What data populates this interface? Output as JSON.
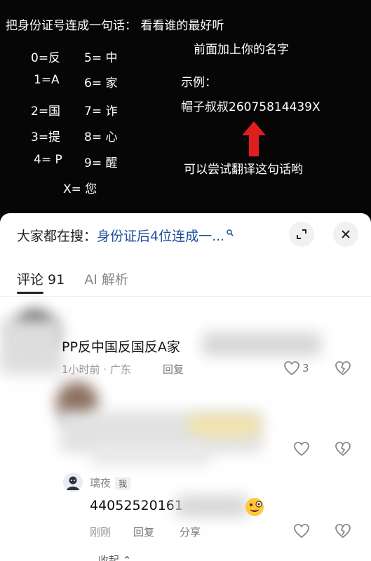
{
  "video": {
    "headline": "把身份证号连成一句话： 看看谁的最好听",
    "mapping": [
      {
        "l": "0=反",
        "r": "5= 中"
      },
      {
        "l": "1=A",
        "r": "6= 家"
      },
      {
        "l": "2=国",
        "r": "7= 诈"
      },
      {
        "l": "3=提",
        "r": "8= 心"
      },
      {
        "l": "4= P",
        "r": "9= 醒"
      }
    ],
    "mapping_x": "X= 您",
    "instruction": "前面加上你的名字",
    "example_label": "示例：",
    "example_value": "帽子叔叔26075814439X",
    "try_text": "可以尝试翻译这句话哟"
  },
  "sheet": {
    "search_prefix": "大家都在搜：",
    "search_query": "身份证后4位连成一...",
    "tabs": [
      {
        "label": "评论 91",
        "active": true
      },
      {
        "label": "AI 解析",
        "active": false
      }
    ]
  },
  "comments": [
    {
      "text": "PP反中国反国反A家",
      "time": "1小时前 · 广东",
      "reply": "回复",
      "likes": "3"
    },
    {
      "text": "",
      "time": "",
      "reply": "",
      "likes": ""
    }
  ],
  "reply": {
    "user": "璃夜",
    "badge": "我",
    "text": "44052520161",
    "time": "刚刚",
    "reply": "回复",
    "share": "分享",
    "collapse": "收起"
  },
  "colors": {
    "accent": "#1f4e9e",
    "arrow": "#e01e1e"
  }
}
